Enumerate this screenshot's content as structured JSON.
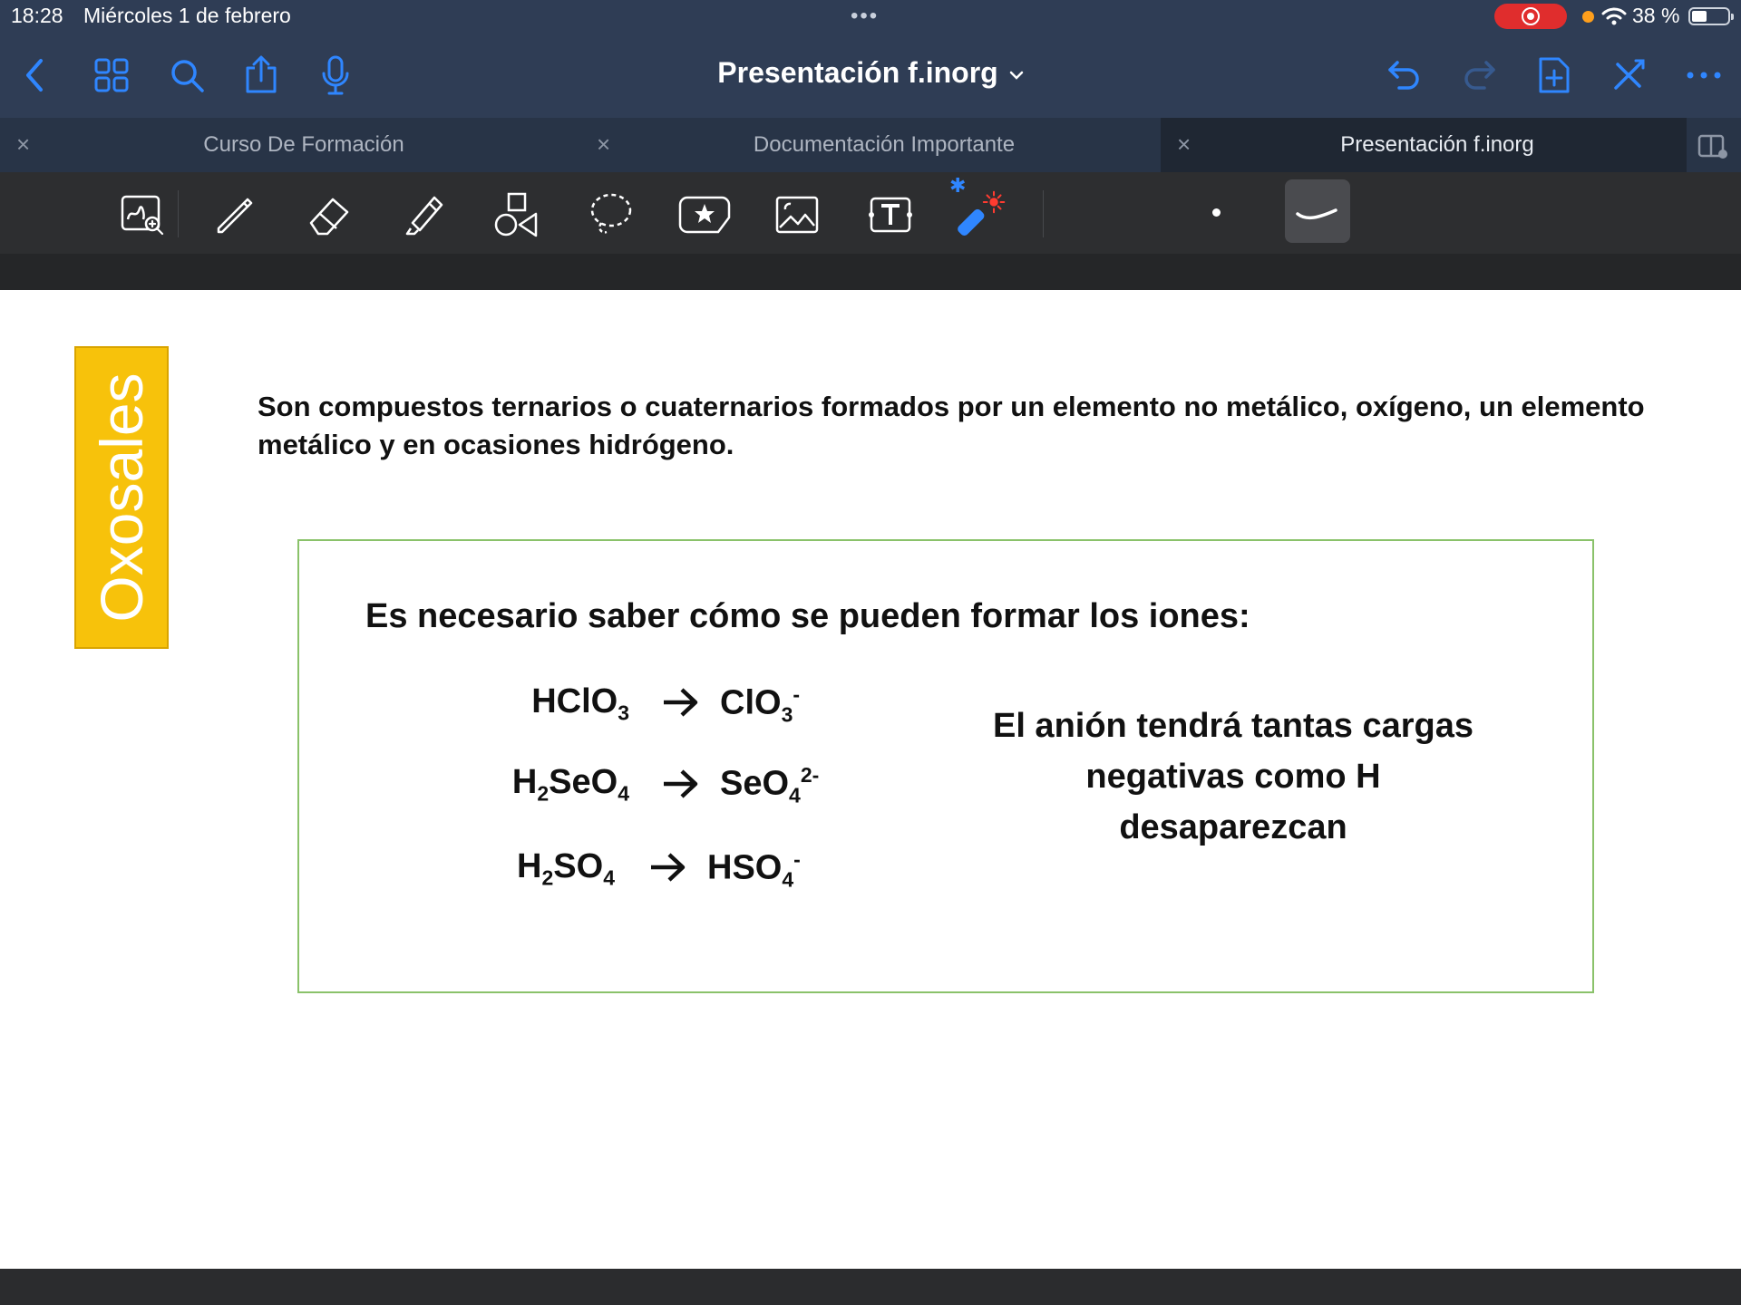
{
  "status_bar": {
    "time": "18:28",
    "date": "Miércoles 1 de febrero",
    "more": "•••",
    "battery": "38 %"
  },
  "nav": {
    "title": "Presentación f.inorg",
    "icons": [
      "back-icon",
      "grid-icon",
      "search-icon",
      "share-icon",
      "microphone-icon",
      "undo-icon",
      "redo-icon",
      "add-page-icon",
      "close-toolbar-icon",
      "more-icon"
    ],
    "accent": "#2f86ff"
  },
  "tabs": [
    {
      "label": "Curso De Formación",
      "close": "×",
      "active": false
    },
    {
      "label": "Documentación Importante",
      "close": "×",
      "active": false
    },
    {
      "label": "Presentación f.inorg",
      "close": "×",
      "active": true
    }
  ],
  "toolbar": {
    "tools": [
      "zoom-window",
      "pen",
      "eraser",
      "highlighter",
      "shapes",
      "lasso",
      "elements",
      "image",
      "text",
      "laser-pointer"
    ],
    "bluetooth": "✱"
  },
  "slide": {
    "side_title": "Oxosales",
    "side_color": "#f7c20b",
    "intro": "Son compuestos ternarios o cuaternarios formados por un elemento no metálico, oxígeno, un elemento metálico y en ocasiones hidrógeno.",
    "box_heading": "Es necesario saber cómo se pueden formar los iones:",
    "arrow": "→",
    "equations": [
      {
        "left_prefix": "HClO",
        "left_sub": "3",
        "right_prefix": "ClO",
        "right_sub": "3",
        "right_sup": "-"
      },
      {
        "left_h": "H",
        "left_h_sub": "2",
        "left_prefix": "SeO",
        "left_sub": "4",
        "right_prefix": "SeO",
        "right_sub": "4",
        "right_sup": "2-"
      },
      {
        "left_h": "H",
        "left_h_sub": "2",
        "left_prefix": "SO",
        "left_sub": "4",
        "right_prefix": "HSO",
        "right_sub": "4",
        "right_sup": "-"
      }
    ],
    "note_lines": [
      "El anión tendrá tantas cargas",
      "negativas como H",
      "desaparezcan"
    ]
  }
}
